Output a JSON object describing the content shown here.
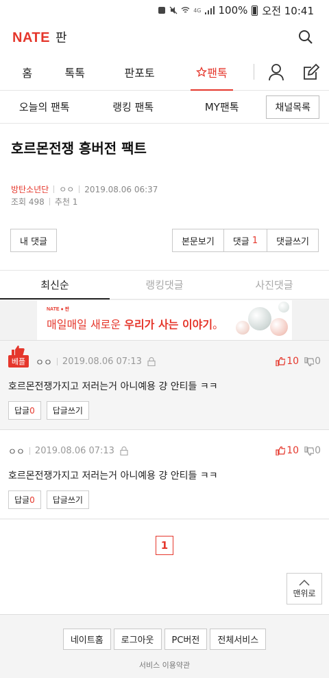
{
  "status_bar": {
    "battery": "100%",
    "time": "오전 10:41",
    "network": "4G"
  },
  "header": {
    "logo": "NATE",
    "section": "판"
  },
  "main_nav": {
    "tabs": [
      "홈",
      "톡톡",
      "판포토",
      "팬톡"
    ],
    "active": "팬톡"
  },
  "sub_nav": {
    "items": [
      "오늘의 팬톡",
      "랭킹 팬톡",
      "MY팬톡"
    ],
    "channel_button": "채널목록"
  },
  "post": {
    "title": "호르몬전쟁 흥버전 팩트",
    "author": "방탄소년단",
    "nickname": "ㅇㅇ",
    "date": "2019.08.06 06:37",
    "views_label": "조회 498",
    "recommend_label": "추천 1"
  },
  "actions": {
    "my_comments": "내 댓글",
    "view_body": "본문보기",
    "comments_label": "댓글",
    "comments_count": "1",
    "write_comment": "댓글쓰기"
  },
  "comment_tabs": {
    "tabs": [
      "최신순",
      "랭킹댓글",
      "사진댓글"
    ],
    "active": "최신순"
  },
  "ad": {
    "logo": "NATE ● 판",
    "text_prefix": "매일매일 새로운 ",
    "text_bold": "우리가 사는 이야기",
    "text_suffix": "。"
  },
  "comments": [
    {
      "best": true,
      "best_label": "베플",
      "nickname": "ㅇㅇ",
      "date": "2019.08.06 07:13",
      "up": "10",
      "down": "0",
      "body": "호르몬전쟁가지고 저러는거 아니예용 걍 안티들 ㅋㅋ",
      "reply_label": "답글",
      "reply_count": "0",
      "reply_write": "답글쓰기"
    },
    {
      "best": false,
      "nickname": "ㅇㅇ",
      "date": "2019.08.06 07:13",
      "up": "10",
      "down": "0",
      "body": "호르몬전쟁가지고 저러는거 아니예용 걍 안티들 ㅋㅋ",
      "reply_label": "답글",
      "reply_count": "0",
      "reply_write": "답글쓰기"
    }
  ],
  "pager": {
    "current": "1"
  },
  "top_button": "맨위로",
  "footer": {
    "buttons": [
      "네이트홈",
      "로그아웃",
      "PC버전",
      "전체서비스"
    ],
    "terms": "서비스 이용약관"
  },
  "colors": {
    "accent": "#e5372c"
  }
}
